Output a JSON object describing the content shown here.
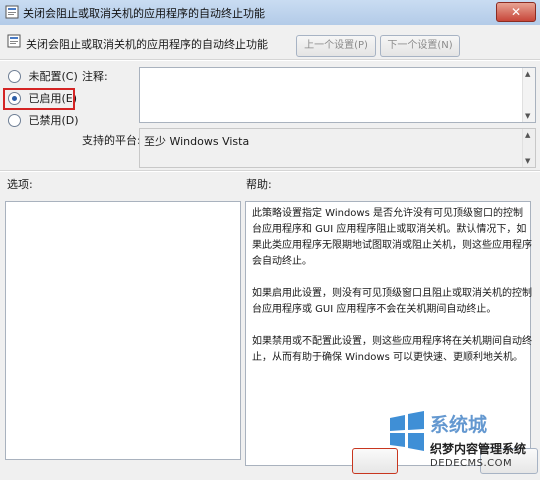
{
  "window": {
    "title": "关闭会阻止或取消关机的应用程序的自动终止功能",
    "close_glyph": "✕"
  },
  "header": {
    "policy_name": "关闭会阻止或取消关机的应用程序的自动终止功能",
    "prev_button": "上一个设置(P)",
    "next_button": "下一个设置(N)"
  },
  "state": {
    "options": [
      {
        "label": "未配置(C)",
        "checked": false
      },
      {
        "label": "已启用(E)",
        "checked": true
      },
      {
        "label": "已禁用(D)",
        "checked": false
      }
    ]
  },
  "comment": {
    "label": "注释:",
    "value": ""
  },
  "platform": {
    "label": "支持的平台:",
    "value": "至少 Windows Vista"
  },
  "options_panel": {
    "label": "选项:"
  },
  "help_panel": {
    "label": "帮助:",
    "paragraphs": [
      "此策略设置指定 Windows 是否允许没有可见顶级窗口的控制台应用程序和 GUI 应用程序阻止或取消关机。默认情况下，如果此类应用程序无限期地试图取消或阻止关机，则这些应用程序会自动终止。",
      "如果启用此设置，则没有可见顶级窗口且阻止或取消关机的控制台应用程序或 GUI 应用程序不会在关机期间自动终止。",
      "如果禁用或不配置此设置，则这些应用程序将在关机期间自动终止，从而有助于确保 Windows 可以更快速、更顺利地关机。"
    ]
  },
  "watermark": {
    "brand": "系统城",
    "subtitle": "织梦内容管理系统",
    "url": "DEDECMS.COM"
  },
  "colors": {
    "highlight_border": "#d42424",
    "title_bar": "#b3cbe8"
  }
}
